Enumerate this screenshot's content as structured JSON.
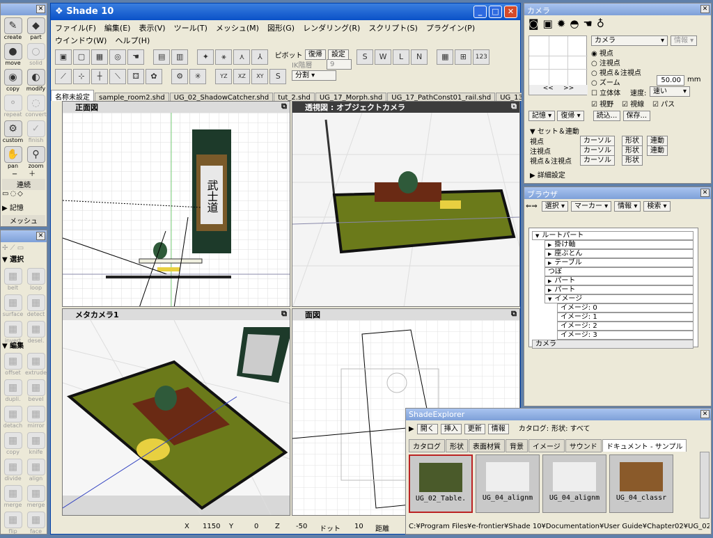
{
  "tool_palette": {
    "tools": [
      {
        "label": "create",
        "icon": "✎",
        "dim": false
      },
      {
        "label": "part",
        "icon": "◆",
        "dim": false
      },
      {
        "label": "move",
        "icon": "●",
        "dim": false
      },
      {
        "label": "solid",
        "icon": "○",
        "dim": true
      },
      {
        "label": "copy",
        "icon": "◉",
        "dim": false
      },
      {
        "label": "modify",
        "icon": "◐",
        "dim": false
      },
      {
        "label": "repeat",
        "icon": "⚬",
        "dim": true
      },
      {
        "label": "convert",
        "icon": "◌",
        "dim": true
      },
      {
        "label": "custom",
        "icon": "⚙",
        "dim": false
      },
      {
        "label": "finish",
        "icon": "✓",
        "dim": true
      },
      {
        "label": "pan",
        "icon": "✋",
        "dim": false
      },
      {
        "label": "zoom",
        "icon": "⚲",
        "dim": false
      }
    ],
    "continuous_label": "連続",
    "memory_label": "記憶",
    "mesh_label": "メッシュ"
  },
  "modify_palette": {
    "select_section": "▼ 選択",
    "edit_section": "▼ 編集",
    "tools": [
      {
        "label": "belt",
        "dim": true
      },
      {
        "label": "loop",
        "dim": true
      },
      {
        "label": "surface",
        "dim": true
      },
      {
        "label": "detect",
        "dim": true
      },
      {
        "label": "invert",
        "dim": true
      },
      {
        "label": "desel.",
        "dim": true
      },
      {
        "label": "offset",
        "dim": true
      },
      {
        "label": "extrude",
        "dim": true
      },
      {
        "label": "dupli.",
        "dim": true
      },
      {
        "label": "bevel",
        "dim": true
      },
      {
        "label": "detach",
        "dim": true
      },
      {
        "label": "mirror",
        "dim": true
      },
      {
        "label": "copy",
        "dim": true
      },
      {
        "label": "knife",
        "dim": true
      },
      {
        "label": "divide",
        "dim": true
      },
      {
        "label": "align",
        "dim": true
      },
      {
        "label": "merge",
        "dim": true
      },
      {
        "label": "merge",
        "dim": true
      },
      {
        "label": "flip",
        "dim": true
      },
      {
        "label": "face",
        "dim": true
      }
    ]
  },
  "main_window": {
    "title": "Shade 10",
    "menu": [
      "ファイル(F)",
      "編集(E)",
      "表示(V)",
      "ツール(T)",
      "メッシュ(M)",
      "図形(G)",
      "レンダリング(R)",
      "スクリプト(S)",
      "プラグイン(P)",
      "ウインドウ(W)",
      "ヘルプ(H)"
    ],
    "pivot_label": "ピボット",
    "restore_label": "復帰",
    "setting_label": "設定",
    "ik_label": "IK階層",
    "ik_value": "9",
    "split_value": "分割",
    "counter": "123",
    "tabs": [
      "名称未設定",
      "sample_room2.shd",
      "UG_02_ShadowCatcher.shd",
      "tut_2.shd",
      "UG_17_Morph.shd",
      "UG_17_PathConst01_rail.shd",
      "UG_13_Bottle"
    ],
    "viewports": {
      "front": "正面図",
      "perspective": "透視図 : オブジェクトカメラ",
      "metacamera": "メタカメラ1",
      "top": "面図"
    },
    "scroll_kanji": "武士道",
    "status": {
      "x_label": "X",
      "x_value": "1150",
      "y_label": "Y",
      "y_value": "0",
      "z_label": "Z",
      "z_value": "-50",
      "dot_label": "ドット",
      "dot_value": "10",
      "dist_label": "距離"
    }
  },
  "camera": {
    "title": "カメラ",
    "select_value": "カメラ",
    "info_label": "情報",
    "radios": [
      "視点",
      "注視点",
      "視点＆注視点",
      "ズーム"
    ],
    "zoom_value": "50.00",
    "zoom_unit": "mm",
    "stereo_label": "立体体",
    "speed_label": "速度:",
    "speed_value": "速い",
    "checks": [
      "視野",
      "視線",
      "パス"
    ],
    "memory_btn": "記憶",
    "restore_btn": "復帰",
    "load_btn": "読込...",
    "save_btn": "保存...",
    "set_section": "▼ セット＆連動",
    "rows": [
      {
        "label": "視点",
        "cursor": "カーソル",
        "shape": "形状",
        "link": "連動"
      },
      {
        "label": "注視点",
        "cursor": "カーソル",
        "shape": "形状",
        "link": "連動"
      },
      {
        "label": "視点＆注視点",
        "cursor": "カーソル",
        "shape": "形状",
        "link": ""
      }
    ],
    "detail_section": "▶ 詳細設定"
  },
  "browser": {
    "title": "ブラウザ",
    "toolbar": [
      "選択",
      "マーカー",
      "情報",
      "検索"
    ],
    "tree": [
      {
        "label": "ルートパート",
        "depth": 0,
        "arrow": "▼"
      },
      {
        "label": "掛け軸",
        "depth": 1,
        "arrow": "▶"
      },
      {
        "label": "座ぶとん",
        "depth": 1,
        "arrow": "▶"
      },
      {
        "label": "テーブル",
        "depth": 1,
        "arrow": "▶"
      },
      {
        "label": "つぼ",
        "depth": 1,
        "arrow": ""
      },
      {
        "label": "パート",
        "depth": 1,
        "arrow": "▶"
      },
      {
        "label": "パート",
        "depth": 1,
        "arrow": "▶"
      },
      {
        "label": "イメージ",
        "depth": 1,
        "arrow": "▼"
      },
      {
        "label": "イメージ: 0",
        "depth": 2,
        "arrow": ""
      },
      {
        "label": "イメージ: 1",
        "depth": 2,
        "arrow": ""
      },
      {
        "label": "イメージ: 2",
        "depth": 2,
        "arrow": ""
      },
      {
        "label": "イメージ: 3",
        "depth": 2,
        "arrow": ""
      },
      {
        "label": "カメラ",
        "depth": 0,
        "arrow": ""
      }
    ]
  },
  "explorer": {
    "title": "ShadeExplorer",
    "buttons": [
      "開く",
      "挿入",
      "更新",
      "情報"
    ],
    "catalog_label": "カタログ:",
    "catalog_value": "形状: すべて",
    "tabs": [
      "カタログ",
      "形状",
      "表面材質",
      "背景",
      "イメージ",
      "サウンド",
      "ドキュメント - サンプル"
    ],
    "thumbs": [
      "UG_02_Table.",
      "UG_04_alignm",
      "UG_04_alignm",
      "UG_04_classr"
    ],
    "path": "C:¥Program Files¥e-frontier¥Shade 10¥Documentation¥User Guide¥Chapter02¥UG_02_Table"
  }
}
